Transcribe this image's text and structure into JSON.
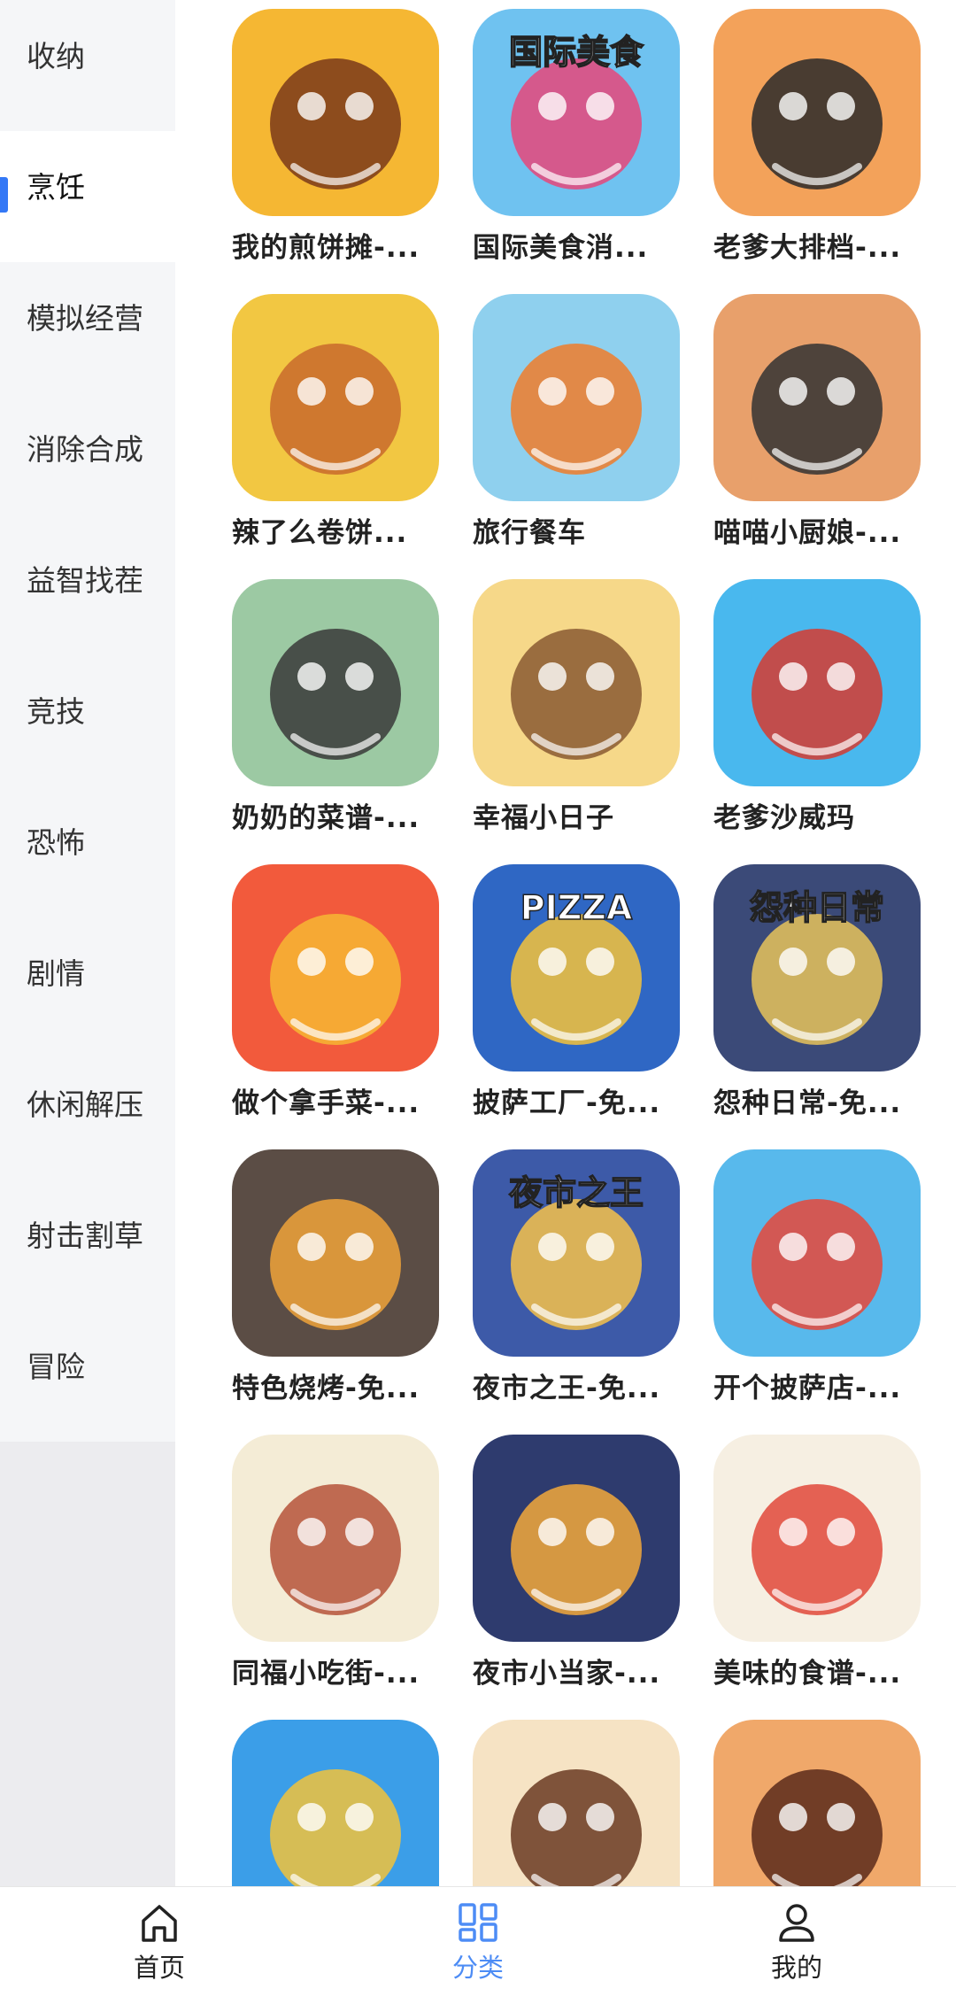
{
  "sidebar": {
    "items": [
      {
        "label": "收纳"
      },
      {
        "label": "烹饪"
      },
      {
        "label": "模拟经营"
      },
      {
        "label": "消除合成"
      },
      {
        "label": "益智找茬"
      },
      {
        "label": "竞技"
      },
      {
        "label": "恐怖"
      },
      {
        "label": "剧情"
      },
      {
        "label": "休闲解压"
      },
      {
        "label": "射击割草"
      },
      {
        "label": "冒险"
      }
    ],
    "active_label": "烹饪",
    "active_color": "#3478f6"
  },
  "games": [
    {
      "title": "我的煎饼摊-...",
      "bg": "#f5b733",
      "fg": "#7a3a1a",
      "icon": "pancake-stall-icon"
    },
    {
      "title": "国际美食消...",
      "bg": "#6fc2f0",
      "fg": "#e8467a",
      "icon": "international-food-icon",
      "art_text": "国际美食"
    },
    {
      "title": "老爹大排档-...",
      "bg": "#f3a25a",
      "fg": "#2a2a2a",
      "icon": "wok-fry-icon"
    },
    {
      "title": "辣了么卷饼...",
      "bg": "#f2c742",
      "fg": "#c96a2b",
      "icon": "burrito-icon"
    },
    {
      "title": "旅行餐车",
      "bg": "#8fd0ee",
      "fg": "#f07c2a",
      "icon": "food-truck-icon"
    },
    {
      "title": "喵喵小厨娘-...",
      "bg": "#e8a06b",
      "fg": "#333333",
      "icon": "cat-chef-icon"
    },
    {
      "title": "奶奶的菜谱-...",
      "bg": "#9cc9a3",
      "fg": "#3a3a3a",
      "icon": "grandma-wok-icon"
    },
    {
      "title": "幸福小日子",
      "bg": "#f6d889",
      "fg": "#8a5a33",
      "icon": "bear-pizza-icon"
    },
    {
      "title": "老爹沙威玛",
      "bg": "#49b8ee",
      "fg": "#d63a2f",
      "icon": "shawarma-icon"
    },
    {
      "title": "做个拿手菜-...",
      "bg": "#f25a3c",
      "fg": "#f7b733",
      "icon": "festive-dish-icon"
    },
    {
      "title": "披萨工厂-免...",
      "bg": "#2f67c4",
      "fg": "#f5c33b",
      "icon": "pizza-factory-icon",
      "art_text": "PIZZA"
    },
    {
      "title": "怨种日常-免...",
      "bg": "#3b4a78",
      "fg": "#e8c35a",
      "icon": "daily-life-icon",
      "art_text": "怨种日常"
    },
    {
      "title": "特色烧烤-免...",
      "bg": "#5b4d45",
      "fg": "#f0a33a",
      "icon": "bbq-icon"
    },
    {
      "title": "夜市之王-免...",
      "bg": "#3d5aa8",
      "fg": "#f6c24a",
      "icon": "night-market-icon",
      "art_text": "夜市之王"
    },
    {
      "title": "开个披萨店-...",
      "bg": "#58b9ec",
      "fg": "#e8473a",
      "icon": "pizza-shop-icon"
    },
    {
      "title": "同福小吃街-...",
      "bg": "#f4ecd6",
      "fg": "#b5533a",
      "icon": "snack-street-icon"
    },
    {
      "title": "夜市小当家-...",
      "bg": "#2e3b6e",
      "fg": "#f2a93b",
      "icon": "night-chef-icon"
    },
    {
      "title": "美味的食谱-...",
      "bg": "#f6efe2",
      "fg": "#e0483a",
      "icon": "pizza-recipe-icon"
    },
    {
      "title": "",
      "bg": "#3b9ee8",
      "fg": "#f2c23b",
      "icon": "burger-boy-icon"
    },
    {
      "title": "",
      "bg": "#f6e3c4",
      "fg": "#6a3a22",
      "icon": "lady-chef-icon"
    },
    {
      "title": "",
      "bg": "#f0a86a",
      "fg": "#5a2a1a",
      "icon": "mustache-man-icon"
    }
  ],
  "tabbar": {
    "home_label": "首页",
    "category_label": "分类",
    "mine_label": "我的",
    "active_color": "#4d8cf5"
  }
}
